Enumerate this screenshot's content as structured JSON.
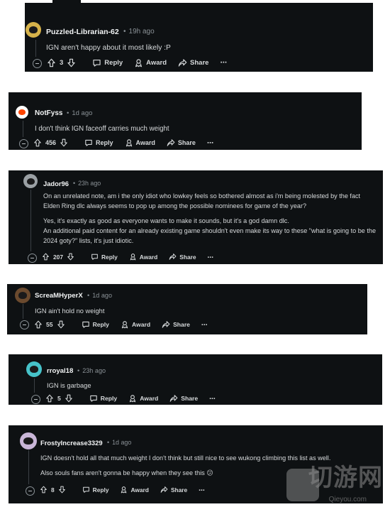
{
  "comments": [
    {
      "author": "Puzzled-Librarian-62",
      "dot": "•",
      "time": "19h ago",
      "body": [
        "IGN aren't happy about it most likely :P"
      ],
      "votes": "3",
      "reply": "Reply",
      "award": "Award",
      "share": "Share",
      "more": "⋯",
      "avatar_icon": "snoo-avatar-icon",
      "avatar_color": "#d6b24a"
    },
    {
      "author": "NotFyss",
      "dot": "•",
      "time": "1d ago",
      "body": [
        "I don't think IGN faceoff carries much weight"
      ],
      "votes": "456",
      "reply": "Reply",
      "award": "Award",
      "share": "Share",
      "more": "⋯",
      "avatar_icon": "snoo-avatar-icon",
      "avatar_color": "#ffffff"
    },
    {
      "author": "Jador96",
      "dot": "•",
      "time": "23h ago",
      "body": [
        "On an unrelated note, am i the only idiot who lowkey feels so bothered almost as i'm being molested by the fact Elden Ring dlc always seems to pop up among the possible nominees for game of the year?",
        "Yes, it's exactly as good as everyone wants to make it sounds, but it's a god damn dlc.\nAn additional paid content for an already existing game shouldn't even make its way to these \"what is going to be the 2024 goty?\" lists, it's just idiotic."
      ],
      "votes": "207",
      "reply": "Reply",
      "award": "Award",
      "share": "Share",
      "more": "⋯",
      "avatar_icon": "snoo-avatar-icon",
      "avatar_color": "#9aa0a4"
    },
    {
      "author": "ScreaMHyperX",
      "dot": "•",
      "time": "1d ago",
      "body": [
        "IGN ain't hold no weight"
      ],
      "votes": "55",
      "reply": "Reply",
      "award": "Award",
      "share": "Share",
      "more": "⋯",
      "avatar_icon": "custom-avatar-icon",
      "avatar_color": "#6b4a2e"
    },
    {
      "author": "rroyal18",
      "dot": "•",
      "time": "23h ago",
      "body": [
        "IGN is garbage"
      ],
      "votes": "5",
      "reply": "Reply",
      "award": "Award",
      "share": "Share",
      "more": "⋯",
      "avatar_icon": "snoo-avatar-icon",
      "avatar_color": "#46c2c9"
    },
    {
      "author": "FrostyIncrease3329",
      "dot": "•",
      "time": "1d ago",
      "body": [
        "IGN doesn't hold all that much weight I don't think but still nice to see wukong climbing this list as well.",
        "Also souls fans aren't gonna be happy when they see this 😕"
      ],
      "votes": "8",
      "reply": "Reply",
      "award": "Award",
      "share": "Share",
      "more": "⋯",
      "avatar_icon": "snoo-avatar-icon",
      "avatar_color": "#c9b6d8"
    }
  ],
  "watermark": {
    "text": "切游网",
    "sub": "Qieyou.com"
  }
}
